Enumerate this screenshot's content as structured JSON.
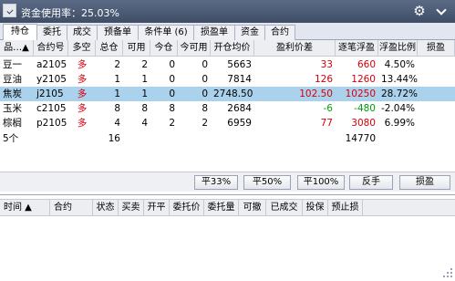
{
  "topbar": {
    "title": "资金使用率：25.03%",
    "gear": "⚙"
  },
  "tabs": [
    "持仓",
    "委托",
    "成交",
    "预备单",
    "条件单 (6)",
    "损盈单",
    "资金",
    "合约"
  ],
  "positions": {
    "headers": [
      "品…▲",
      "合约号",
      "多空",
      "总仓",
      "可用",
      "今仓",
      "今可用",
      "开仓均价",
      "盈利价差",
      "逐笔浮盈",
      "浮盈比例",
      "损盈"
    ],
    "rows": [
      {
        "name": "豆一",
        "code": "a2105",
        "dir": "多",
        "total": "2",
        "avail": "2",
        "today": "0",
        "today_avail": "0",
        "open_price": "5663",
        "diff": "33",
        "pnl": "660",
        "ratio": "4.50%",
        "stop": ""
      },
      {
        "name": "豆油",
        "code": "y2105",
        "dir": "多",
        "total": "1",
        "avail": "1",
        "today": "0",
        "today_avail": "0",
        "open_price": "7814",
        "diff": "126",
        "pnl": "1260",
        "ratio": "13.44%",
        "stop": ""
      },
      {
        "name": "焦炭",
        "code": "j2105",
        "dir": "多",
        "total": "1",
        "avail": "1",
        "today": "0",
        "today_avail": "0",
        "open_price": "2748.50",
        "diff": "102.50",
        "pnl": "10250",
        "ratio": "28.72%",
        "stop": ""
      },
      {
        "name": "玉米",
        "code": "c2105",
        "dir": "多",
        "total": "8",
        "avail": "8",
        "today": "8",
        "today_avail": "8",
        "open_price": "2684",
        "diff": "-6",
        "pnl": "-480",
        "ratio": "-2.04%",
        "stop": ""
      },
      {
        "name": "棕榈",
        "code": "p2105",
        "dir": "多",
        "total": "4",
        "avail": "4",
        "today": "2",
        "today_avail": "2",
        "open_price": "6959",
        "diff": "77",
        "pnl": "3080",
        "ratio": "6.99%",
        "stop": ""
      }
    ],
    "summary": {
      "count": "5个",
      "total": "16",
      "pnl": "14770"
    },
    "selected_row": 2
  },
  "buttons": [
    "平33%",
    "平50%",
    "平100%",
    "反手",
    "损盈"
  ],
  "orders": {
    "headers": [
      "时间 ▲",
      "合约",
      "状态",
      "买卖",
      "开平",
      "委托价",
      "委托量",
      "可撤",
      "已成交",
      "投保",
      "预止损"
    ]
  },
  "colors": {
    "up": "#d3000a",
    "down": "#0a9a12",
    "selected": "#aad2ec",
    "header_bg": "#4a5874"
  }
}
